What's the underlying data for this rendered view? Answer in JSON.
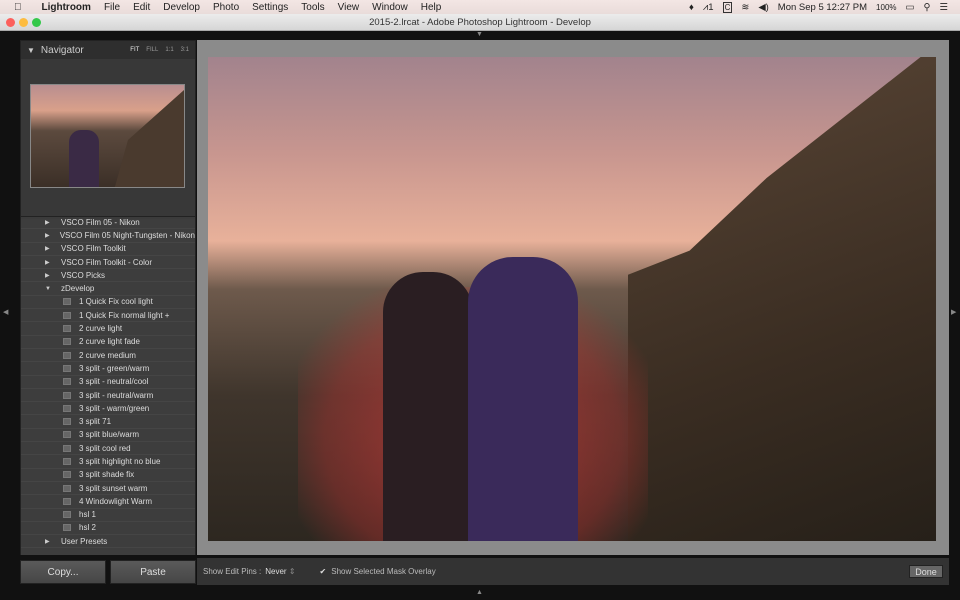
{
  "menubar": {
    "app": "Lightroom",
    "items": [
      "File",
      "Edit",
      "Develop",
      "Photo",
      "Settings",
      "Tools",
      "View",
      "Window",
      "Help"
    ],
    "status": {
      "adobe": "1",
      "datetime": "Mon Sep 5  12:27 PM",
      "battery": "100%"
    }
  },
  "window": {
    "title": "2015-2.lrcat - Adobe Photoshop Lightroom - Develop"
  },
  "navigator": {
    "title": "Navigator",
    "zoom_options": [
      "FIT",
      "FILL",
      "1:1",
      "3:1"
    ]
  },
  "presets": [
    {
      "type": "folder",
      "label": "VSCO Film 05 - Nikon"
    },
    {
      "type": "folder",
      "label": "VSCO Film 05 Night-Tungsten - Nikon"
    },
    {
      "type": "folder",
      "label": "VSCO Film Toolkit"
    },
    {
      "type": "folder",
      "label": "VSCO Film Toolkit - Color"
    },
    {
      "type": "folder",
      "label": "VSCO Picks"
    },
    {
      "type": "open",
      "label": "zDevelop"
    },
    {
      "type": "preset",
      "label": "1 Quick Fix cool light"
    },
    {
      "type": "preset",
      "label": "1 Quick Fix normal light +"
    },
    {
      "type": "preset",
      "label": "2 curve light"
    },
    {
      "type": "preset",
      "label": "2 curve light fade"
    },
    {
      "type": "preset",
      "label": "2 curve medium"
    },
    {
      "type": "preset",
      "label": "3 split - green/warm"
    },
    {
      "type": "preset",
      "label": "3 split - neutral/cool"
    },
    {
      "type": "preset",
      "label": "3 split - neutral/warm"
    },
    {
      "type": "preset",
      "label": "3 split - warm/green"
    },
    {
      "type": "preset",
      "label": "3 split 71"
    },
    {
      "type": "preset",
      "label": "3 split blue/warm"
    },
    {
      "type": "preset",
      "label": "3 split cool red"
    },
    {
      "type": "preset",
      "label": "3 split highlight no blue"
    },
    {
      "type": "preset",
      "label": "3 split shade fix"
    },
    {
      "type": "preset",
      "label": "3 split sunset warm"
    },
    {
      "type": "preset",
      "label": "4 Windowlight Warm"
    },
    {
      "type": "preset",
      "label": "hsl 1"
    },
    {
      "type": "preset",
      "label": "hsl 2"
    },
    {
      "type": "folder",
      "label": "User Presets"
    }
  ],
  "buttons": {
    "copy": "Copy...",
    "paste": "Paste"
  },
  "toolbar": {
    "edit_pins_label": "Show Edit Pins :",
    "edit_pins_value": "Never",
    "mask_overlay_label": "Show Selected Mask Overlay",
    "mask_overlay_checked": true,
    "done": "Done"
  }
}
